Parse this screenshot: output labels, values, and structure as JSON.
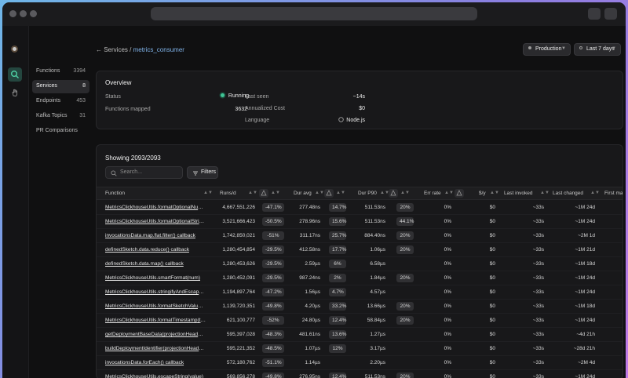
{
  "sidebar": {
    "items": [
      {
        "label": "Functions",
        "count": "3394"
      },
      {
        "label": "Services",
        "count": "8"
      },
      {
        "label": "Endpoints",
        "count": "453"
      },
      {
        "label": "Kafka Topics",
        "count": "31"
      },
      {
        "label": "PR Comparisons",
        "count": ""
      }
    ]
  },
  "breadcrumb": {
    "back": "← Services /",
    "current": "metrics_consumer"
  },
  "filters": {
    "environment": "Production",
    "timerange": "Last 7 days"
  },
  "overview": {
    "title": "Overview",
    "status_label": "Status",
    "status_value": "Running",
    "functions_label": "Functions mapped",
    "functions_value": "3632",
    "last_seen_label": "Last seen",
    "last_seen_value": "~14s",
    "cost_label": "Annualized Cost",
    "cost_value": "$0",
    "language_label": "Language",
    "language_value": "Node.js"
  },
  "table": {
    "title": "Showing 2093/2093",
    "search_placeholder": "Search...",
    "filters_label": "Filters",
    "columns": {
      "function": "Function",
      "runs": "Runs/d",
      "dur_avg": "Dur avg",
      "dur_p90": "Dur P90",
      "err_rate": "Err rate",
      "cost": "$/y",
      "last_invoked": "Last invoked",
      "last_changed": "Last changed",
      "first": "First ma"
    },
    "rows": [
      {
        "fn": "MetricsClickhouseUtils.formatOptionalNumb...",
        "runs": "4,667,551,226",
        "runs_d": "-47.1%",
        "avg": "277.48ns",
        "avg_d": "14.7%",
        "p90": "511.53ns",
        "p90_d": "20%",
        "err": "0%",
        "cost": "$0",
        "invoked": "~33s",
        "changed": "~1M 24d"
      },
      {
        "fn": "MetricsClickhouseUtils.formatOptionalString(...",
        "runs": "3,521,666,423",
        "runs_d": "-50.5%",
        "avg": "278.96ns",
        "avg_d": "15.6%",
        "p90": "511.53ns",
        "p90_d": "44.1%",
        "err": "0%",
        "cost": "$0",
        "invoked": "~33s",
        "changed": "~1M 24d"
      },
      {
        "fn": "invocationsData.map.flat.filter() callback",
        "runs": "1,742,850,021",
        "runs_d": "-51%",
        "avg": "311.17ns",
        "avg_d": "25.7%",
        "p90": "884.40ns",
        "p90_d": "20%",
        "err": "0%",
        "cost": "$0",
        "invoked": "~33s",
        "changed": "~2M 1d"
      },
      {
        "fn": "definedSketch.data.reduce() callback",
        "runs": "1,280,454,854",
        "runs_d": "-29.5%",
        "avg": "412.58ns",
        "avg_d": "17.7%",
        "p90": "1.06µs",
        "p90_d": "20%",
        "err": "0%",
        "cost": "$0",
        "invoked": "~33s",
        "changed": "~1M 21d"
      },
      {
        "fn": "definedSketch.data.map() callback",
        "runs": "1,280,453,626",
        "runs_d": "-29.5%",
        "avg": "2.59µs",
        "avg_d": "6%",
        "p90": "6.58µs",
        "p90_d": "",
        "err": "0%",
        "cost": "$0",
        "invoked": "~33s",
        "changed": "~1M 18d"
      },
      {
        "fn": "MetricsClickhouseUtils.smartFormat(num)",
        "runs": "1,280,452,091",
        "runs_d": "-29.5%",
        "avg": "987.24ns",
        "avg_d": "2%",
        "p90": "1.84µs",
        "p90_d": "20%",
        "err": "0%",
        "cost": "$0",
        "invoked": "~33s",
        "changed": "~1M 24d"
      },
      {
        "fn": "MetricsClickhouseUtils.stringifyAndEscape(JS...",
        "runs": "1,194,897,764",
        "runs_d": "-47.2%",
        "avg": "1.56µs",
        "avg_d": "4.7%",
        "p90": "4.57µs",
        "p90_d": "",
        "err": "0%",
        "cost": "$0",
        "invoked": "~33s",
        "changed": "~1M 24d"
      },
      {
        "fn": "MetricsClickhouseUtils.formatSketchValues(s...",
        "runs": "1,139,720,351",
        "runs_d": "-49.8%",
        "avg": "4.20µs",
        "avg_d": "33.2%",
        "p90": "13.66µs",
        "p90_d": "20%",
        "err": "0%",
        "cost": "$0",
        "invoked": "~33s",
        "changed": "~1M 18d"
      },
      {
        "fn": "MetricsClickhouseUtils.formatTimestamp(tim...",
        "runs": "621,100,777",
        "runs_d": "-52%",
        "avg": "24.80µs",
        "avg_d": "12.4%",
        "p90": "58.84µs",
        "p90_d": "20%",
        "err": "0%",
        "cost": "$0",
        "invoked": "~33s",
        "changed": "~1M 24d"
      },
      {
        "fn": "getDeploymentBaseData(projectionHeaders)",
        "runs": "595,397,028",
        "runs_d": "-48.3%",
        "avg": "481.61ns",
        "avg_d": "13.6%",
        "p90": "1.27µs",
        "p90_d": "",
        "err": "0%",
        "cost": "$0",
        "invoked": "~33s",
        "changed": "~4d 21h"
      },
      {
        "fn": "buildDeploymentIdentifier(projectionHeaders)",
        "runs": "595,221,352",
        "runs_d": "-48.5%",
        "avg": "1.07µs",
        "avg_d": "12%",
        "p90": "3.17µs",
        "p90_d": "",
        "err": "0%",
        "cost": "$0",
        "invoked": "~33s",
        "changed": "~28d 21h"
      },
      {
        "fn": "invocationsData.forEach() callback",
        "runs": "572,180,762",
        "runs_d": "-51.1%",
        "avg": "1.14µs",
        "avg_d": "",
        "p90": "2.20µs",
        "p90_d": "",
        "err": "0%",
        "cost": "$0",
        "invoked": "~33s",
        "changed": "~2M 4d"
      },
      {
        "fn": "MetricsClickhouseUtils.escapeString(value)",
        "runs": "569,856,278",
        "runs_d": "-49.8%",
        "avg": "276.95ns",
        "avg_d": "12.4%",
        "p90": "511.53ns",
        "p90_d": "20%",
        "err": "0%",
        "cost": "$0",
        "invoked": "~33s",
        "changed": "~1M 24d"
      }
    ]
  },
  "colors": {
    "accent": "#3fc495",
    "link": "#7fb2e8",
    "background": "#101011"
  }
}
